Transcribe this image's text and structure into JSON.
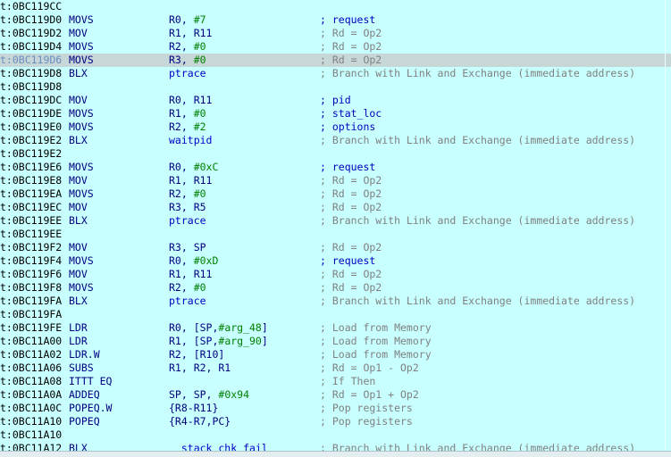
{
  "listing": {
    "rows": [
      {
        "addr": "t:0BC119CC"
      },
      {
        "addr": "t:0BC119D0",
        "mnem": "MOVS",
        "ops": [
          {
            "t": "R0, "
          },
          {
            "t": "#7",
            "k": "imm"
          }
        ],
        "cmt": "; request",
        "named": true
      },
      {
        "addr": "t:0BC119D2",
        "mnem": "MOV",
        "ops": [
          {
            "t": "R1, R11"
          }
        ],
        "cmt": "; Rd = Op2"
      },
      {
        "addr": "t:0BC119D4",
        "mnem": "MOVS",
        "ops": [
          {
            "t": "R2, "
          },
          {
            "t": "#0",
            "k": "imm"
          }
        ],
        "cmt": "; Rd = Op2"
      },
      {
        "addr": "t:0BC119D6",
        "mnem": "MOVS",
        "ops": [
          {
            "t": "R3, "
          },
          {
            "t": "#0",
            "k": "imm"
          }
        ],
        "cmt": "; Rd = Op2",
        "selected": true
      },
      {
        "addr": "t:0BC119D8",
        "mnem": "BLX",
        "ops": [
          {
            "t": "ptrace",
            "k": "sym"
          }
        ],
        "cmt": "; Branch with Link and Exchange (immediate address)"
      },
      {
        "addr": "t:0BC119D8"
      },
      {
        "addr": "t:0BC119DC",
        "mnem": "MOV",
        "ops": [
          {
            "t": "R0, R11"
          }
        ],
        "cmt": "; pid",
        "named": true
      },
      {
        "addr": "t:0BC119DE",
        "mnem": "MOVS",
        "ops": [
          {
            "t": "R1, "
          },
          {
            "t": "#0",
            "k": "imm"
          }
        ],
        "cmt": "; stat_loc",
        "named": true
      },
      {
        "addr": "t:0BC119E0",
        "mnem": "MOVS",
        "ops": [
          {
            "t": "R2, "
          },
          {
            "t": "#2",
            "k": "imm"
          }
        ],
        "cmt": "; options",
        "named": true
      },
      {
        "addr": "t:0BC119E2",
        "mnem": "BLX",
        "ops": [
          {
            "t": "waitpid",
            "k": "sym"
          }
        ],
        "cmt": "; Branch with Link and Exchange (immediate address)"
      },
      {
        "addr": "t:0BC119E2"
      },
      {
        "addr": "t:0BC119E6",
        "mnem": "MOVS",
        "ops": [
          {
            "t": "R0, "
          },
          {
            "t": "#0xC",
            "k": "imm"
          }
        ],
        "cmt": "; request",
        "named": true
      },
      {
        "addr": "t:0BC119E8",
        "mnem": "MOV",
        "ops": [
          {
            "t": "R1, R11"
          }
        ],
        "cmt": "; Rd = Op2"
      },
      {
        "addr": "t:0BC119EA",
        "mnem": "MOVS",
        "ops": [
          {
            "t": "R2, "
          },
          {
            "t": "#0",
            "k": "imm"
          }
        ],
        "cmt": "; Rd = Op2"
      },
      {
        "addr": "t:0BC119EC",
        "mnem": "MOV",
        "ops": [
          {
            "t": "R3, R5"
          }
        ],
        "cmt": "; Rd = Op2"
      },
      {
        "addr": "t:0BC119EE",
        "mnem": "BLX",
        "ops": [
          {
            "t": "ptrace",
            "k": "sym"
          }
        ],
        "cmt": "; Branch with Link and Exchange (immediate address)"
      },
      {
        "addr": "t:0BC119EE"
      },
      {
        "addr": "t:0BC119F2",
        "mnem": "MOV",
        "ops": [
          {
            "t": "R3, SP"
          }
        ],
        "cmt": "; Rd = Op2"
      },
      {
        "addr": "t:0BC119F4",
        "mnem": "MOVS",
        "ops": [
          {
            "t": "R0, "
          },
          {
            "t": "#0xD",
            "k": "imm"
          }
        ],
        "cmt": "; request",
        "named": true
      },
      {
        "addr": "t:0BC119F6",
        "mnem": "MOV",
        "ops": [
          {
            "t": "R1, R11"
          }
        ],
        "cmt": "; Rd = Op2"
      },
      {
        "addr": "t:0BC119F8",
        "mnem": "MOVS",
        "ops": [
          {
            "t": "R2, "
          },
          {
            "t": "#0",
            "k": "imm"
          }
        ],
        "cmt": "; Rd = Op2"
      },
      {
        "addr": "t:0BC119FA",
        "mnem": "BLX",
        "ops": [
          {
            "t": "ptrace",
            "k": "sym"
          }
        ],
        "cmt": "; Branch with Link and Exchange (immediate address)"
      },
      {
        "addr": "t:0BC119FA"
      },
      {
        "addr": "t:0BC119FE",
        "mnem": "LDR",
        "ops": [
          {
            "t": "R0, [SP,"
          },
          {
            "t": "#arg_48",
            "k": "stk"
          },
          {
            "t": "]"
          }
        ],
        "cmt": "; Load from Memory"
      },
      {
        "addr": "t:0BC11A00",
        "mnem": "LDR",
        "ops": [
          {
            "t": "R1, [SP,"
          },
          {
            "t": "#arg_90",
            "k": "stk"
          },
          {
            "t": "]"
          }
        ],
        "cmt": "; Load from Memory"
      },
      {
        "addr": "t:0BC11A02",
        "mnem": "LDR.W",
        "ops": [
          {
            "t": "R2, [R10]"
          }
        ],
        "cmt": "; Load from Memory"
      },
      {
        "addr": "t:0BC11A06",
        "mnem": "SUBS",
        "ops": [
          {
            "t": "R1, R2, R1"
          }
        ],
        "cmt": "; Rd = Op1 - Op2"
      },
      {
        "addr": "t:0BC11A08",
        "mnem": "ITTT EQ",
        "ops": [],
        "cmt": "; If Then"
      },
      {
        "addr": "t:0BC11A0A",
        "mnem": "ADDEQ",
        "ops": [
          {
            "t": "SP, SP, "
          },
          {
            "t": "#0x94",
            "k": "imm"
          }
        ],
        "cmt": "; Rd = Op1 + Op2"
      },
      {
        "addr": "t:0BC11A0C",
        "mnem": "POPEQ.W",
        "ops": [
          {
            "t": "{R8-R11}"
          }
        ],
        "cmt": "; Pop registers"
      },
      {
        "addr": "t:0BC11A10",
        "mnem": "POPEQ",
        "ops": [
          {
            "t": "{R4-R7,PC}"
          }
        ],
        "cmt": "; Pop registers"
      },
      {
        "addr": "t:0BC11A10"
      },
      {
        "addr": "t:0BC11A12",
        "mnem": "BLX",
        "ops": [
          {
            "t": "__stack_chk_fail",
            "k": "sym"
          }
        ],
        "cmt": "; Branch with Link and Exchange (immediate address)"
      }
    ]
  }
}
